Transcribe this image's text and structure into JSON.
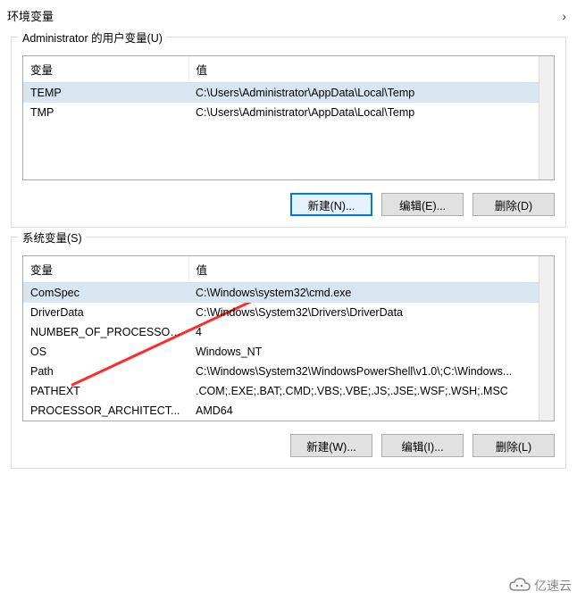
{
  "dialog": {
    "title": "环境变量",
    "close": "›"
  },
  "userSection": {
    "label": "Administrator 的用户变量(U)",
    "col_var": "变量",
    "col_val": "值",
    "rows": [
      {
        "name": "TEMP",
        "value": "C:\\Users\\Administrator\\AppData\\Local\\Temp",
        "selected": true
      },
      {
        "name": "TMP",
        "value": "C:\\Users\\Administrator\\AppData\\Local\\Temp",
        "selected": false
      }
    ],
    "buttons": {
      "new": "新建(N)...",
      "edit": "编辑(E)...",
      "delete": "删除(D)"
    }
  },
  "sysSection": {
    "label": "系统变量(S)",
    "col_var": "变量",
    "col_val": "值",
    "rows": [
      {
        "name": "ComSpec",
        "value": "C:\\Windows\\system32\\cmd.exe",
        "selected": true
      },
      {
        "name": "DriverData",
        "value": "C:\\Windows\\System32\\Drivers\\DriverData",
        "selected": false
      },
      {
        "name": "NUMBER_OF_PROCESSORS",
        "value": "4",
        "selected": false
      },
      {
        "name": "OS",
        "value": "Windows_NT",
        "selected": false
      },
      {
        "name": "Path",
        "value": "C:\\Windows\\System32\\WindowsPowerShell\\v1.0\\;C:\\Windows...",
        "selected": false
      },
      {
        "name": "PATHEXT",
        "value": ".COM;.EXE;.BAT;.CMD;.VBS;.VBE;.JS;.JSE;.WSF;.WSH;.MSC",
        "selected": false
      },
      {
        "name": "PROCESSOR_ARCHITECT...",
        "value": "AMD64",
        "selected": false
      }
    ],
    "buttons": {
      "new": "新建(W)...",
      "edit": "编辑(I)...",
      "delete": "删除(L)"
    }
  },
  "watermark": "亿速云"
}
